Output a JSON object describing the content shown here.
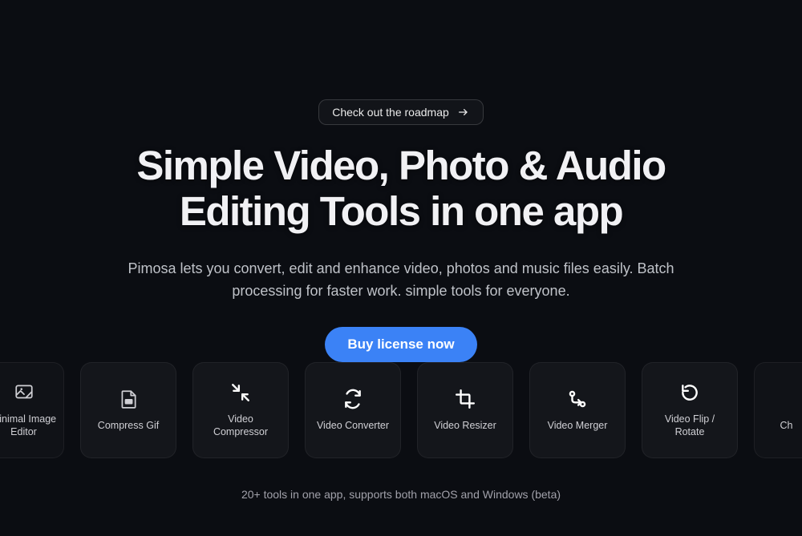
{
  "roadmap": {
    "label": "Check out the roadmap"
  },
  "headline": {
    "line1": "Simple Video, Photo & Audio",
    "line2": "Editing Tools in one app"
  },
  "subhead": "Pimosa lets you convert, edit and enhance video, photos and music files easily. Batch processing for faster work. simple tools for everyone.",
  "cta": {
    "label": "Buy license now"
  },
  "tools": [
    {
      "label": "Minimal Image Editor",
      "icon": "image-edit-icon"
    },
    {
      "label": "Compress Gif",
      "icon": "gif-icon"
    },
    {
      "label": "Video Compressor",
      "icon": "compress-icon"
    },
    {
      "label": "Video Converter",
      "icon": "convert-icon"
    },
    {
      "label": "Video Resizer",
      "icon": "crop-icon"
    },
    {
      "label": "Video Merger",
      "icon": "merge-icon"
    },
    {
      "label": "Video Flip / Rotate",
      "icon": "rotate-icon"
    },
    {
      "label": "Ch",
      "icon": ""
    }
  ],
  "footnote": "20+ tools in one app, supports both macOS and Windows (beta)"
}
